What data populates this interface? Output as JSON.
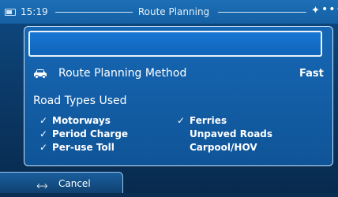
{
  "status_bar": {
    "time": "15:19",
    "title": "Route Planning",
    "icons": [
      "battery-icon",
      "satellite-icon",
      "more-dots-icon"
    ]
  },
  "panel": {
    "name_field_value": "",
    "planning_method": {
      "icon": "car-icon",
      "label": "Route Planning Method",
      "value": "Fast"
    },
    "road_types": {
      "title": "Road Types Used",
      "items": [
        {
          "label": "Motorways",
          "checked": true
        },
        {
          "label": "Period Charge",
          "checked": true
        },
        {
          "label": "Per-use Toll",
          "checked": true
        },
        {
          "label": "Ferries",
          "checked": true
        },
        {
          "label": "Unpaved Roads",
          "checked": false
        },
        {
          "label": "Carpool/HOV",
          "checked": false
        }
      ]
    }
  },
  "bottom": {
    "cancel_label": "Cancel"
  },
  "colors": {
    "background": "#0b3a69",
    "status_bar": "#1766ac",
    "panel": "#1768b5",
    "text": "#ffffff"
  }
}
